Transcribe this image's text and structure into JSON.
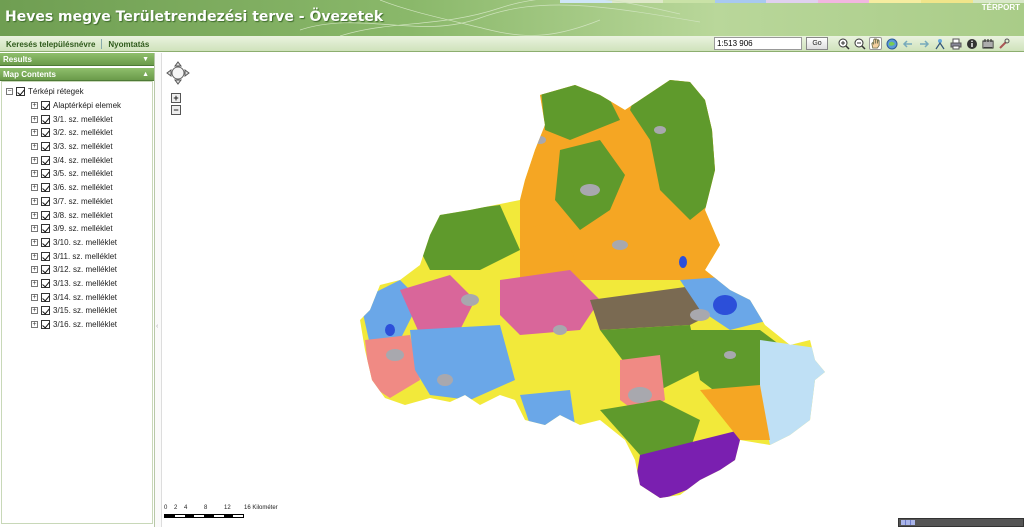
{
  "header": {
    "title": "Heves megye Területrendezési terve - Övezetek",
    "brand": "TÉRPORT"
  },
  "toolbar": {
    "menu": [
      "Keresés településnévre",
      "Nyomtatás"
    ],
    "scale_value": "1:513 906",
    "go_label": "Go",
    "tools": [
      {
        "name": "zoom-in-icon",
        "color": "#3a5"
      },
      {
        "name": "zoom-out-icon",
        "color": "#3a5"
      },
      {
        "name": "pan-hand-icon",
        "color": "#d7a"
      },
      {
        "name": "full-extent-icon",
        "color": "#47b"
      },
      {
        "name": "back-arrow-icon",
        "color": "#8ab"
      },
      {
        "name": "forward-arrow-icon",
        "color": "#8ab"
      },
      {
        "name": "measure-icon",
        "color": "#69b"
      },
      {
        "name": "print-icon",
        "color": "#678"
      },
      {
        "name": "info-icon",
        "color": "#333"
      },
      {
        "name": "legend-icon",
        "color": "#222"
      },
      {
        "name": "tools-icon",
        "color": "#b55"
      }
    ]
  },
  "left_panel": {
    "results_label": "Results",
    "contents_label": "Map Contents",
    "root_layer": "Térképi rétegek",
    "layers": [
      "Alaptérképi elemek",
      "3/1. sz. melléklet",
      "3/2. sz. melléklet",
      "3/3. sz. melléklet",
      "3/4. sz. melléklet",
      "3/5. sz. melléklet",
      "3/6. sz. melléklet",
      "3/7. sz. melléklet",
      "3/8. sz. melléklet",
      "3/9. sz. melléklet",
      "3/10. sz. melléklet",
      "3/11. sz. melléklet",
      "3/12. sz. melléklet",
      "3/13. sz. melléklet",
      "3/14. sz. melléklet",
      "3/15. sz. melléklet",
      "3/16. sz. melléklet"
    ]
  },
  "map": {
    "scalebar": {
      "ticks": [
        "0",
        "2",
        "4",
        "8",
        "12",
        "16 Kilométer"
      ]
    },
    "colors": {
      "forest": "#5f9a2c",
      "agri": "#f5a623",
      "yellow": "#f2e93a",
      "pink": "#d9669a",
      "blue": "#6aa7e8",
      "brown": "#7a6a52",
      "gray": "#a8a8ae",
      "salmon": "#f08a84",
      "purple": "#7a1fb0",
      "lightblue": "#bfe0f5"
    }
  }
}
